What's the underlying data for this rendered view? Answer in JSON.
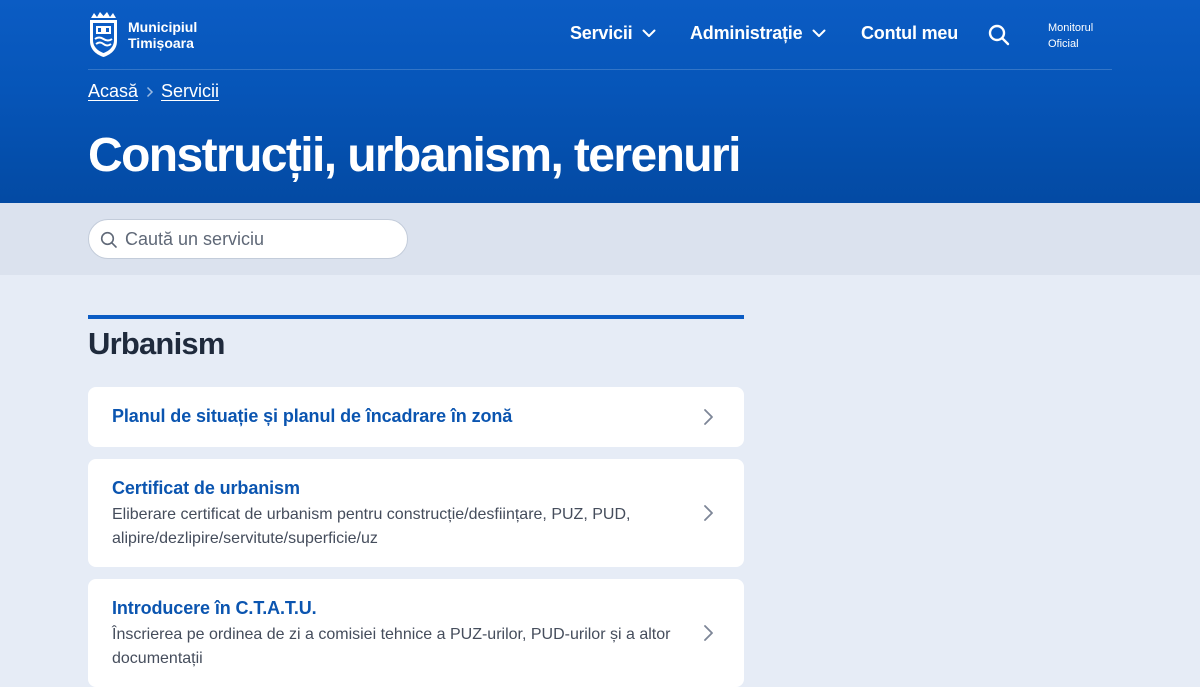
{
  "header": {
    "logo_line1": "Municipiul",
    "logo_line2": "Timișoara",
    "nav": [
      {
        "label": "Servicii"
      },
      {
        "label": "Administrație"
      },
      {
        "label": "Contul meu"
      }
    ],
    "monitor_line1": "Monitorul",
    "monitor_line2": "Oficial"
  },
  "breadcrumb": {
    "home": "Acasă",
    "current": "Servicii"
  },
  "page_title": "Construcții, urbanism, terenuri",
  "search": {
    "placeholder": "Caută un serviciu"
  },
  "section": {
    "title": "Urbanism",
    "items": [
      {
        "title": "Planul de situație și planul de încadrare în zonă"
      },
      {
        "title": "Certificat de urbanism",
        "desc": "Eliberare certificat de urbanism pentru construcție/desființare, PUZ, PUD, alipire/dezlipire/servitute/superficie/uz"
      },
      {
        "title": "Introducere în C.T.A.T.U.",
        "desc": "Înscrierea pe ordinea de zi a comisiei tehnice a PUZ-urilor, PUD-urilor și a altor documentații"
      }
    ]
  },
  "colors": {
    "brand_blue": "#0b5cc4",
    "link_blue": "#0b55b0",
    "page_bg": "#e6ecf6"
  },
  "icons": [
    "city-crest-icon",
    "chevron-down-icon",
    "search-icon",
    "chevron-right-icon"
  ]
}
